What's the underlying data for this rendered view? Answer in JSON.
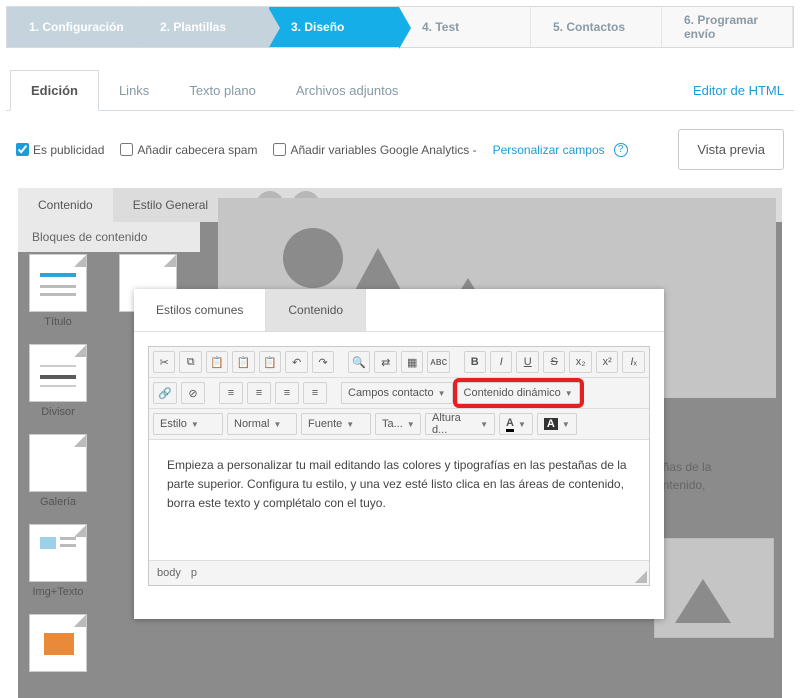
{
  "wizard": {
    "steps": [
      {
        "label": "1. Configuración",
        "state": "past"
      },
      {
        "label": "2. Plantillas",
        "state": "past"
      },
      {
        "label": "3. Diseño",
        "state": "active"
      },
      {
        "label": "4. Test",
        "state": "future"
      },
      {
        "label": "5. Contactos",
        "state": "future"
      },
      {
        "label": "6. Programar envío",
        "state": "future"
      }
    ]
  },
  "subtabs": {
    "items": [
      {
        "label": "Edición",
        "active": true
      },
      {
        "label": "Links",
        "active": false
      },
      {
        "label": "Texto plano",
        "active": false
      },
      {
        "label": "Archivos adjuntos",
        "active": false
      }
    ],
    "html_link": "Editor de HTML"
  },
  "options": {
    "is_ad_label": "Es publicidad",
    "is_ad_checked": true,
    "spam_label": "Añadir cabecera spam",
    "spam_checked": false,
    "ga_label": "Añadir variables Google Analytics -",
    "ga_checked": false,
    "personalize_link": "Personalizar campos",
    "preview_btn": "Vista previa"
  },
  "shell": {
    "tabs": {
      "content": "Contenido",
      "style": "Estilo General"
    },
    "sub_header": "Bloques de contenido",
    "blocks": [
      "Título",
      "Divisor",
      "Galería",
      "Img+Texto"
    ],
    "bg_text": "estañas de la\ne contenido,"
  },
  "dialog": {
    "tabs": {
      "styles": "Estilos comunes",
      "content": "Contenido"
    },
    "toolbar": {
      "campos": "Campos contacto",
      "dinamico": "Contenido dinámico",
      "estilo": "Estilo",
      "normal": "Normal",
      "fuente": "Fuente",
      "tam": "Ta...",
      "altura": "Altura d...",
      "acolor": "A",
      "abg": "A"
    },
    "body_text": "Empieza a personalizar tu mail editando las colores y tipografías en las pestañas de la parte superior. Configura tu estilo, y una vez esté listo clica en las áreas de contenido, borra este texto y complétalo con el tuyo.",
    "paths": {
      "body": "body",
      "p": "p"
    }
  }
}
